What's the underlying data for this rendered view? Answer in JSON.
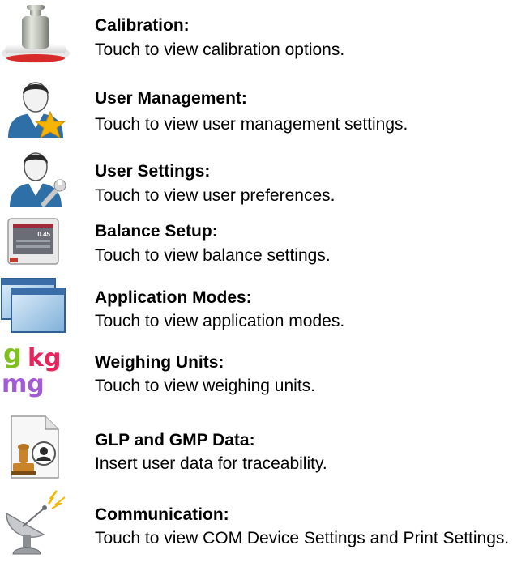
{
  "items": [
    {
      "key": "calibration",
      "icon": "calibration-weight-icon",
      "title": "Calibration:",
      "description": "Touch to view calibration options."
    },
    {
      "key": "user-management",
      "icon": "user-management-icon",
      "title": "User Management:",
      "description": "Touch to view user management settings."
    },
    {
      "key": "user-settings",
      "icon": "user-settings-icon",
      "title": "User Settings:",
      "description": "Touch to view user preferences."
    },
    {
      "key": "balance-setup",
      "icon": "balance-setup-icon",
      "title": "Balance Setup:",
      "description": "Touch to view balance settings."
    },
    {
      "key": "application-modes",
      "icon": "application-modes-icon",
      "title": "Application Modes:",
      "description": "Touch to view application modes."
    },
    {
      "key": "weighing-units",
      "icon": "weighing-units-icon",
      "title": "Weighing Units:",
      "description": "Touch to view weighing units."
    },
    {
      "key": "glp-gmp-data",
      "icon": "glp-gmp-data-icon",
      "title": "GLP and GMP Data:",
      "description": "Insert user data for traceability."
    },
    {
      "key": "communication",
      "icon": "satellite-dish-icon",
      "title": "Communication:",
      "description": "Touch to view COM Device Settings and Print Settings."
    }
  ],
  "icon_text": {
    "balance_display_value": "0.45",
    "unit_g": "g",
    "unit_kg": "kg",
    "unit_mg": "mg"
  },
  "colors": {
    "unit_g": "#7fbf1f",
    "unit_kg": "#e8245c",
    "unit_mg": "#a35ad6",
    "star": "#f5b400",
    "shirt_blue": "#2e6fa8"
  }
}
